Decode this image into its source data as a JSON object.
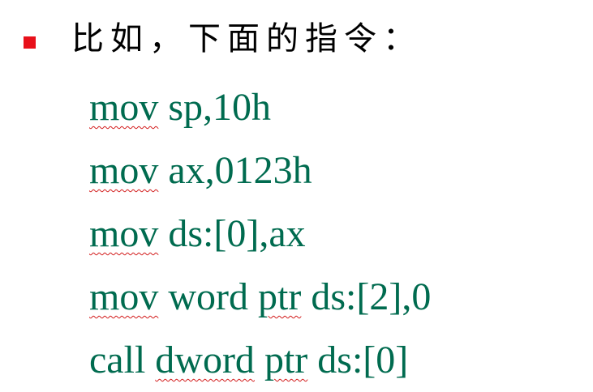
{
  "heading": "比如，下面的指令：",
  "code_lines": [
    [
      {
        "text": "mov",
        "flagged": true
      },
      {
        "text": " sp,10h",
        "flagged": false
      }
    ],
    [
      {
        "text": "mov",
        "flagged": true
      },
      {
        "text": " ax,0123h",
        "flagged": false
      }
    ],
    [
      {
        "text": "mov",
        "flagged": true
      },
      {
        "text": " ds:[0],ax",
        "flagged": false
      }
    ],
    [
      {
        "text": "mov",
        "flagged": true
      },
      {
        "text": " word ",
        "flagged": false
      },
      {
        "text": "ptr",
        "flagged": true
      },
      {
        "text": " ds:[2],0",
        "flagged": false
      }
    ],
    [
      {
        "text": "call ",
        "flagged": false
      },
      {
        "text": "dword",
        "flagged": true
      },
      {
        "text": " ",
        "flagged": false
      },
      {
        "text": "ptr",
        "flagged": true
      },
      {
        "text": " ds:[0]",
        "flagged": false
      }
    ]
  ],
  "colors": {
    "bullet": "#e8101a",
    "code_text": "#006b4f",
    "heading_text": "#000000",
    "spellcheck_underline": "#d21a1a"
  }
}
